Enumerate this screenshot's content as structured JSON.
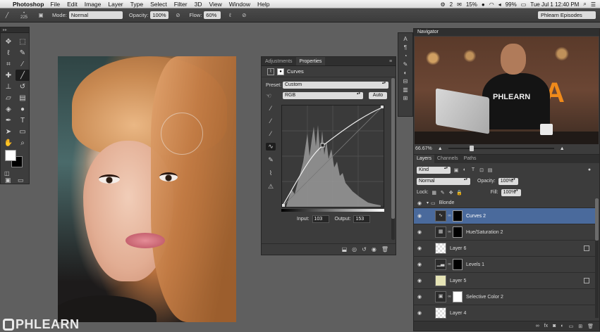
{
  "menubar": {
    "apple": "",
    "app_name": "Photoshop",
    "items": [
      "File",
      "Edit",
      "Image",
      "Layer",
      "Type",
      "Select",
      "Filter",
      "3D",
      "View",
      "Window",
      "Help"
    ],
    "status": {
      "badge": "2",
      "battery_a": "15%",
      "battery_b": "99%",
      "clock": "Tue Jul 1 12:40 PM"
    }
  },
  "options_bar": {
    "brush_size": "225",
    "mode_label": "Mode:",
    "mode_value": "Normal",
    "opacity_label": "Opacity:",
    "opacity_value": "100%",
    "flow_label": "Flow:",
    "flow_value": "60%",
    "workspace": "Phlearn Episodes"
  },
  "properties_panel": {
    "tabs": [
      "Adjustments",
      "Properties"
    ],
    "title": "Curves",
    "preset_label": "Preset:",
    "preset_value": "Custom",
    "channel_value": "RGB",
    "auto_label": "Auto",
    "input_label": "Input:",
    "input_value": "103",
    "output_label": "Output:",
    "output_value": "153"
  },
  "navigator": {
    "title": "Navigator",
    "zoom": "66.67%",
    "preview_shirt_text": "PHLEARN",
    "preview_sign_text": "A"
  },
  "layers_panel": {
    "tabs": [
      "Layers",
      "Channels",
      "Paths"
    ],
    "filter_value": "Kind",
    "blend_mode": "Normal",
    "opacity_label": "Opacity:",
    "opacity_value": "100%",
    "lock_label": "Lock:",
    "fill_label": "Fill:",
    "fill_value": "100%",
    "layers": [
      {
        "name": "Blonde",
        "type": "group",
        "selected": false
      },
      {
        "name": "Curves 2",
        "type": "adjustment",
        "selected": true
      },
      {
        "name": "Hue/Saturation 2",
        "type": "adjustment",
        "selected": false
      },
      {
        "name": "Layer 6",
        "type": "pixel",
        "selected": false
      },
      {
        "name": "Levels 1",
        "type": "adjustment",
        "selected": false
      },
      {
        "name": "Layer 5",
        "type": "pixel",
        "selected": false
      },
      {
        "name": "Selective Color 2",
        "type": "adjustment",
        "selected": false
      },
      {
        "name": "Layer 4",
        "type": "pixel",
        "selected": false
      }
    ]
  },
  "watermark": {
    "text": "PHLEARN"
  }
}
